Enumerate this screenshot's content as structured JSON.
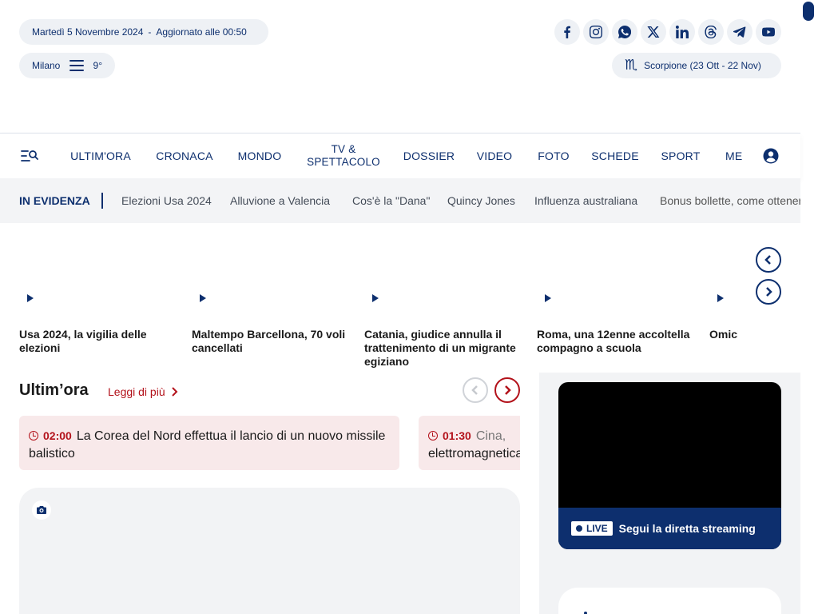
{
  "header": {
    "date_label": "Martedì 5 Novembre 2024",
    "separator": "-",
    "updated_label": "Aggiornato alle 00:50",
    "city": "Milano",
    "temperature": "9°",
    "horoscope_sign": "♏",
    "horoscope_label": "Scorpione (23 Ott - 22 Nov)",
    "socials": [
      "facebook-icon",
      "instagram-icon",
      "whatsapp-icon",
      "x-icon",
      "linkedin-icon",
      "threads-icon",
      "telegram-icon",
      "youtube-icon"
    ]
  },
  "nav": {
    "items": [
      "ULTIM'ORA",
      "CRONACA",
      "MONDO",
      "TV & SPETTACOLO",
      "DOSSIER",
      "VIDEO",
      "FOTO",
      "SCHEDE",
      "SPORT"
    ],
    "tv_line1": "TV &",
    "tv_line2": "SPETTACOLO",
    "partial_item": "METEO"
  },
  "evidence": {
    "title": "IN EVIDENZA",
    "links": [
      "Elezioni Usa 2024",
      "Alluvione a Valencia",
      "Cos'è la \"Dana\"",
      "Quincy Jones",
      "Influenza australiana",
      "Bonus bollette, come ottenerlo"
    ]
  },
  "video_carousel": {
    "items": [
      "Usa 2024, la vigilia delle elezioni",
      "Maltempo Barcellona, 70 voli cancellati",
      "Catania, giudice annulla il trattenimento di un migrante egiziano",
      "Roma, una 12enne accoltella compagno a scuola",
      "Omicidio, fermato psichiatra"
    ]
  },
  "ultimora": {
    "title": "Ultim’ora",
    "more_label": "Leggi di più",
    "news": [
      {
        "time": "02:00",
        "text": "La Corea del Nord effettua il lancio di un nuovo missile balistico"
      },
      {
        "time": "01:30",
        "text": "Cina,",
        "text2": "elettromagnetica"
      }
    ]
  },
  "live": {
    "tag": "LIVE",
    "text": "Segui la diretta streaming"
  },
  "colors": {
    "brand_blue": "#0d2f6e",
    "accent_red": "#b3121b",
    "news_card_bg": "#f8e9ea"
  }
}
